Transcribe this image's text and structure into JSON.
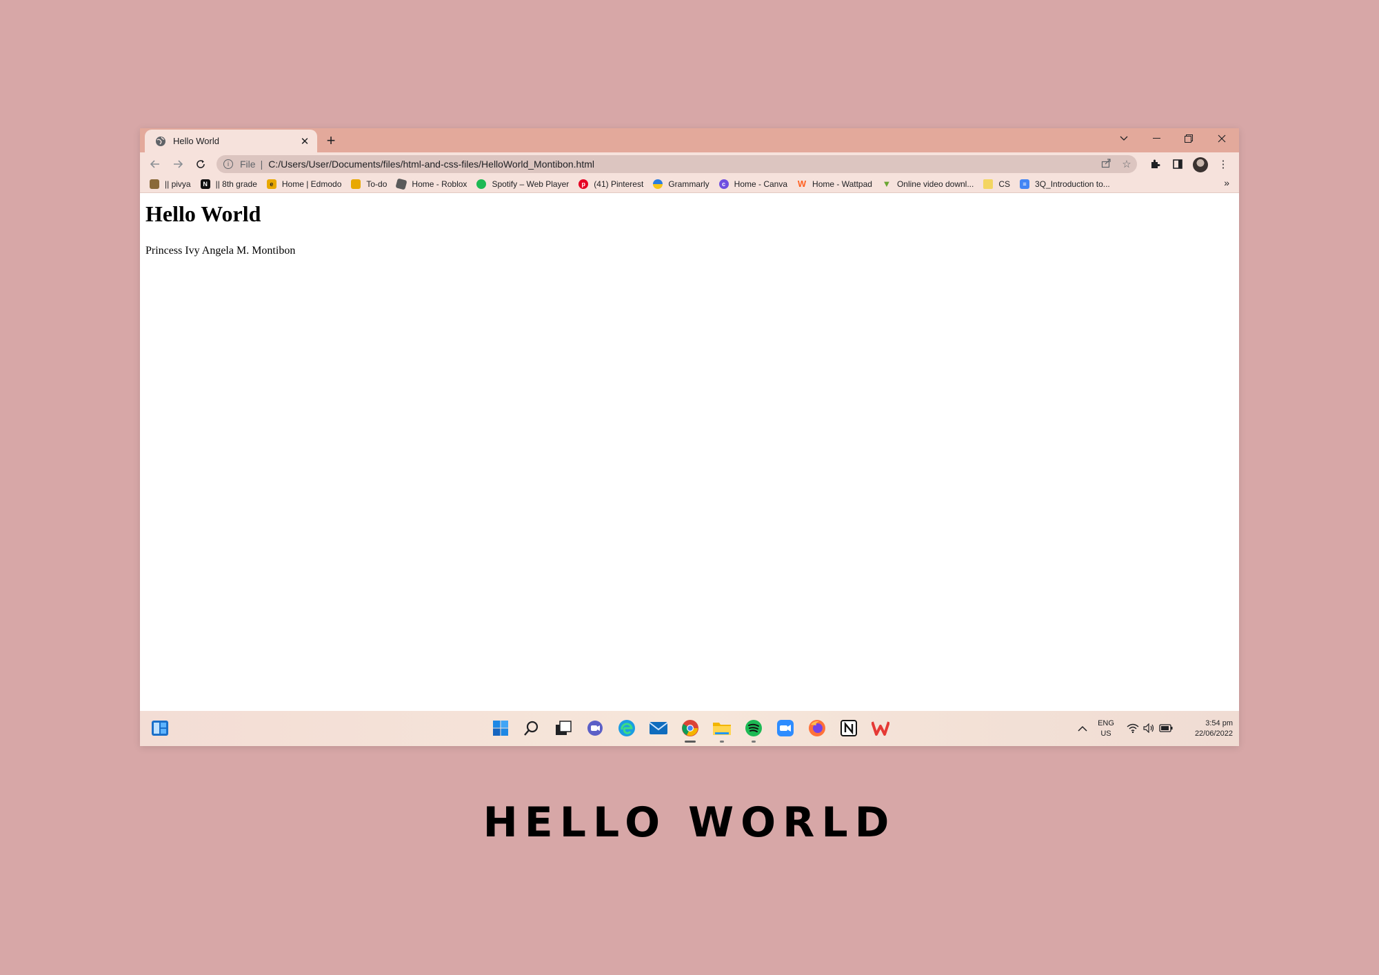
{
  "browser": {
    "tab": {
      "title": "Hello World"
    },
    "address": {
      "scheme": "File",
      "separator": "|",
      "url": "C:/Users/User/Documents/files/html-and-css-files/HelloWorld_Montibon.html"
    },
    "bookmarks": [
      {
        "label": "|| pivya",
        "icon": "photo-icon",
        "color": "#8a6a3a"
      },
      {
        "label": "|| 8th grade",
        "icon": "notion-icon",
        "color": "#111111"
      },
      {
        "label": "Home | Edmodo",
        "icon": "edmodo-icon",
        "color": "#e8a800"
      },
      {
        "label": "To-do",
        "icon": "todo-icon",
        "color": "#e8a800"
      },
      {
        "label": "Home - Roblox",
        "icon": "roblox-icon",
        "color": "#5a5a5a"
      },
      {
        "label": "Spotify – Web Player",
        "icon": "spotify-icon",
        "color": "#1db954"
      },
      {
        "label": "(41) Pinterest",
        "icon": "pinterest-icon",
        "color": "#e60023"
      },
      {
        "label": "Grammarly",
        "icon": "grammarly-icon",
        "color": "#15c39a"
      },
      {
        "label": "Home - Canva",
        "icon": "canva-icon",
        "color": "#6f4ee0"
      },
      {
        "label": "Home - Wattpad",
        "icon": "wattpad-icon",
        "color": "#ff6122"
      },
      {
        "label": "Online video downl...",
        "icon": "download-icon",
        "color": "#6aa632"
      },
      {
        "label": "CS",
        "icon": "folder-icon",
        "color": "#f3d561"
      },
      {
        "label": "3Q_Introduction to...",
        "icon": "docs-icon",
        "color": "#4285f4"
      }
    ],
    "bookmarks_more": "»"
  },
  "page": {
    "heading": "Hello World",
    "text": "Princess Ivy Angela M. Montibon"
  },
  "taskbar": {
    "language_top": "ENG",
    "language_bottom": "US",
    "time": "3:54 pm",
    "date": "22/06/2022"
  },
  "caption": "HELLO WORLD"
}
